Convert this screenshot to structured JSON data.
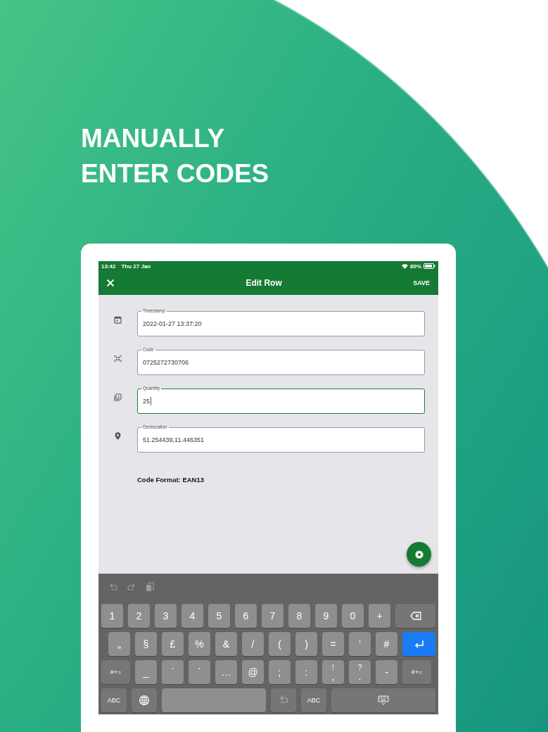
{
  "headline": [
    "MANUALLY",
    "ENTER CODES"
  ],
  "status_bar": {
    "time": "13:42",
    "date": "Thu 27 Jan",
    "battery": "80%"
  },
  "app_bar": {
    "title": "Edit Row",
    "action": "SAVE"
  },
  "fields": [
    {
      "label": "Timestamp",
      "value": "2022-01-27 13:37:20",
      "focused": false
    },
    {
      "label": "Code",
      "value": "0725272730706",
      "focused": false
    },
    {
      "label": "Quantity",
      "value": "25",
      "focused": true
    },
    {
      "label": "Geolocation",
      "value": "51.254439,11.446351",
      "focused": false
    }
  ],
  "code_format": "Code Format: EAN13",
  "keyboard": {
    "rows": [
      [
        {
          "kind": "char",
          "label": "1"
        },
        {
          "kind": "char",
          "label": "2"
        },
        {
          "kind": "char",
          "label": "3"
        },
        {
          "kind": "char",
          "label": "4"
        },
        {
          "kind": "char",
          "label": "5"
        },
        {
          "kind": "char",
          "label": "6"
        },
        {
          "kind": "char",
          "label": "7"
        },
        {
          "kind": "char",
          "label": "8"
        },
        {
          "kind": "char",
          "label": "9"
        },
        {
          "kind": "char",
          "label": "0"
        },
        {
          "kind": "char",
          "label": "+"
        },
        {
          "kind": "delete"
        }
      ],
      [
        {
          "kind": "char",
          "label": "„"
        },
        {
          "kind": "char",
          "label": "§"
        },
        {
          "kind": "char",
          "label": "£"
        },
        {
          "kind": "char",
          "label": "%"
        },
        {
          "kind": "char",
          "label": "&"
        },
        {
          "kind": "char",
          "label": "/"
        },
        {
          "kind": "char",
          "label": "("
        },
        {
          "kind": "char",
          "label": ")"
        },
        {
          "kind": "char",
          "label": "="
        },
        {
          "kind": "char",
          "label": "'"
        },
        {
          "kind": "char",
          "label": "#"
        },
        {
          "kind": "return"
        }
      ],
      [
        {
          "kind": "mode",
          "label": "#+="
        },
        {
          "kind": "char",
          "label": "_"
        },
        {
          "kind": "char",
          "label": "`"
        },
        {
          "kind": "char",
          "label": "´"
        },
        {
          "kind": "char",
          "label": "…"
        },
        {
          "kind": "char",
          "label": "@"
        },
        {
          "kind": "char",
          "label": ";"
        },
        {
          "kind": "char",
          "label": ":"
        },
        {
          "kind": "char",
          "top": "!",
          "label": ","
        },
        {
          "kind": "char",
          "top": "?",
          "label": "."
        },
        {
          "kind": "char",
          "label": "-"
        },
        {
          "kind": "mode",
          "label": "#+="
        }
      ],
      [
        {
          "kind": "mode",
          "label": "ABC"
        },
        {
          "kind": "globe"
        },
        {
          "kind": "space"
        },
        {
          "kind": "undo"
        },
        {
          "kind": "mode",
          "label": "ABC"
        },
        {
          "kind": "hide"
        }
      ]
    ]
  }
}
